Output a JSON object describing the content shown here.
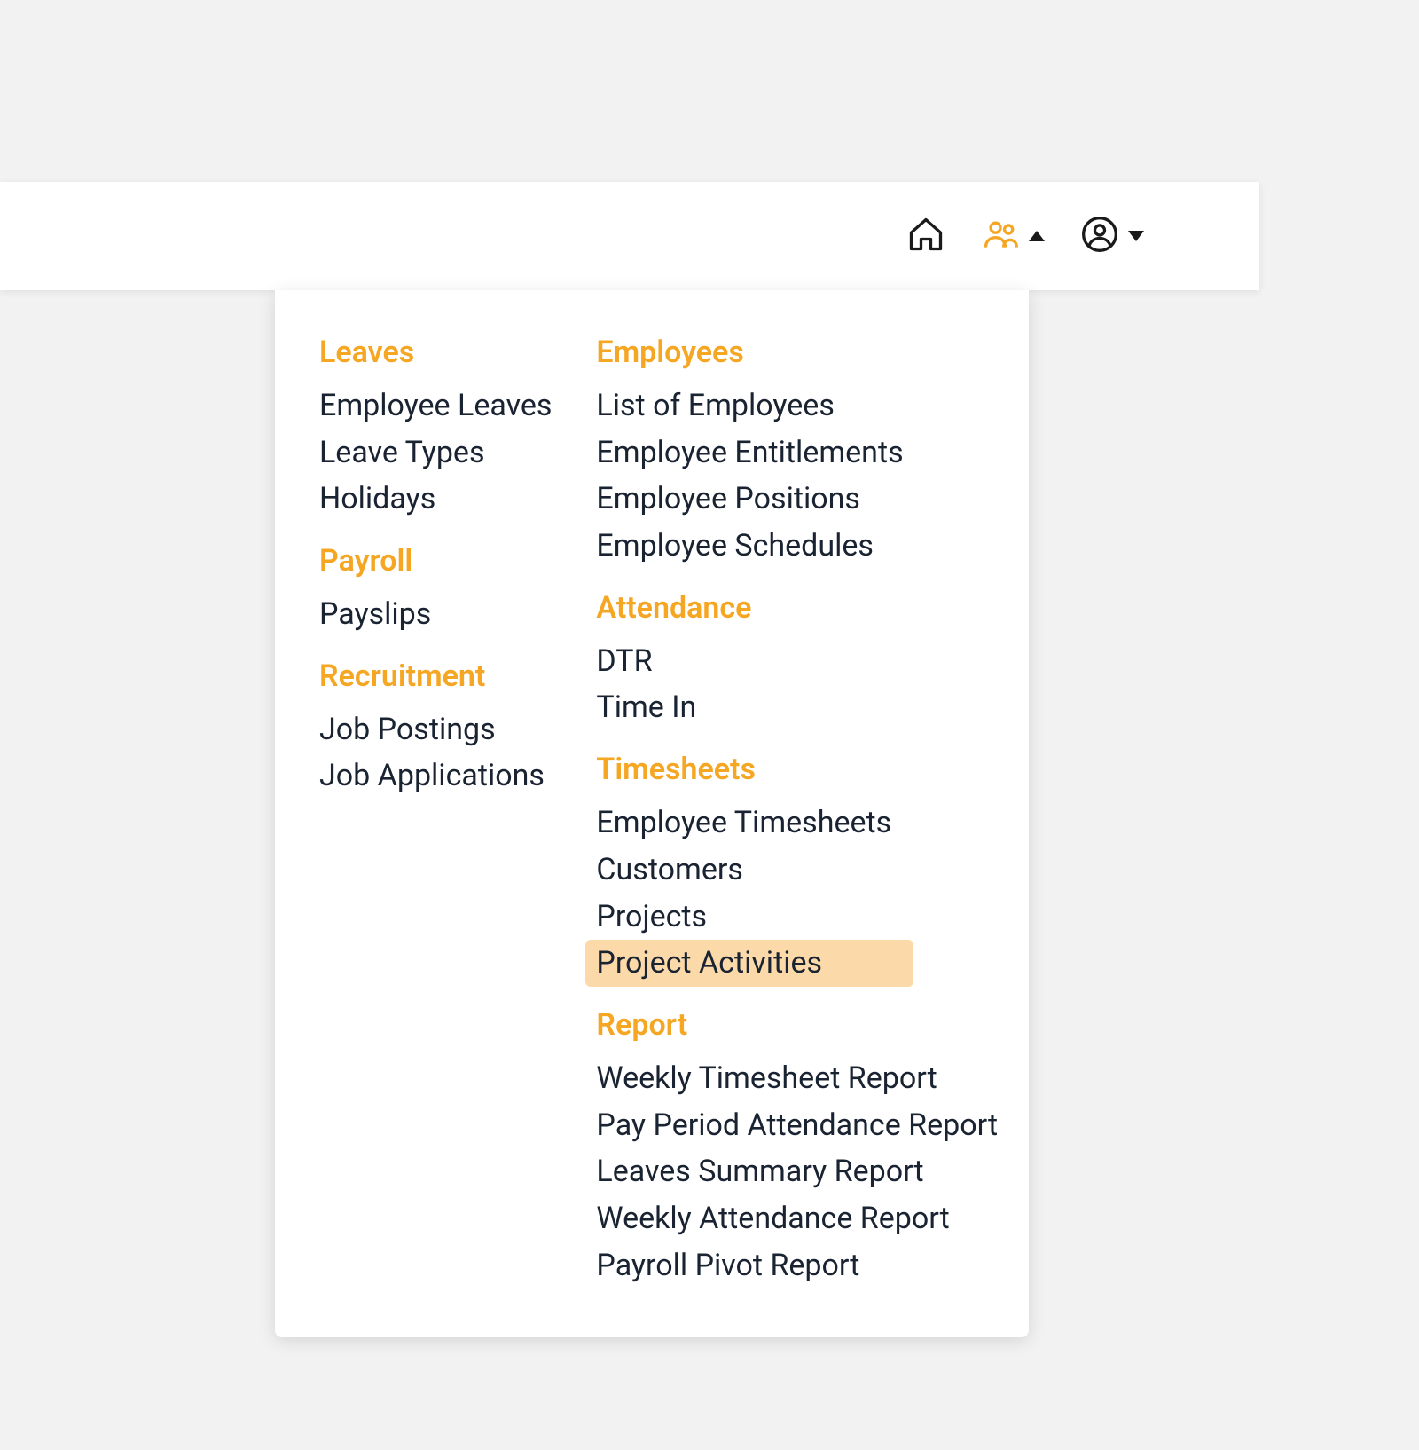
{
  "colors": {
    "accent": "#f5a623",
    "highlight": "#fcd9a8",
    "text": "#1a2332",
    "bg": "#f2f2f2",
    "panel": "#ffffff"
  },
  "topbar": {
    "home_icon": "home-icon",
    "people_icon": "people-icon",
    "user_icon": "user-icon"
  },
  "menu": {
    "left": [
      {
        "heading": "Leaves",
        "items": [
          "Employee Leaves",
          "Leave Types",
          "Holidays"
        ]
      },
      {
        "heading": "Payroll",
        "items": [
          "Payslips"
        ]
      },
      {
        "heading": "Recruitment",
        "items": [
          "Job Postings",
          "Job Applications"
        ]
      }
    ],
    "right": [
      {
        "heading": "Employees",
        "items": [
          "List of Employees",
          "Employee Entitlements",
          "Employee Positions",
          "Employee Schedules"
        ]
      },
      {
        "heading": "Attendance",
        "items": [
          "DTR",
          "Time In"
        ]
      },
      {
        "heading": "Timesheets",
        "items": [
          "Employee Timesheets",
          "Customers",
          "Projects",
          "Project Activities"
        ]
      },
      {
        "heading": "Report",
        "items": [
          "Weekly Timesheet Report",
          "Pay Period Attendance Report",
          "Leaves Summary Report",
          "Weekly Attendance Report",
          "Payroll Pivot Report"
        ]
      }
    ],
    "highlighted_item": "Project Activities"
  }
}
